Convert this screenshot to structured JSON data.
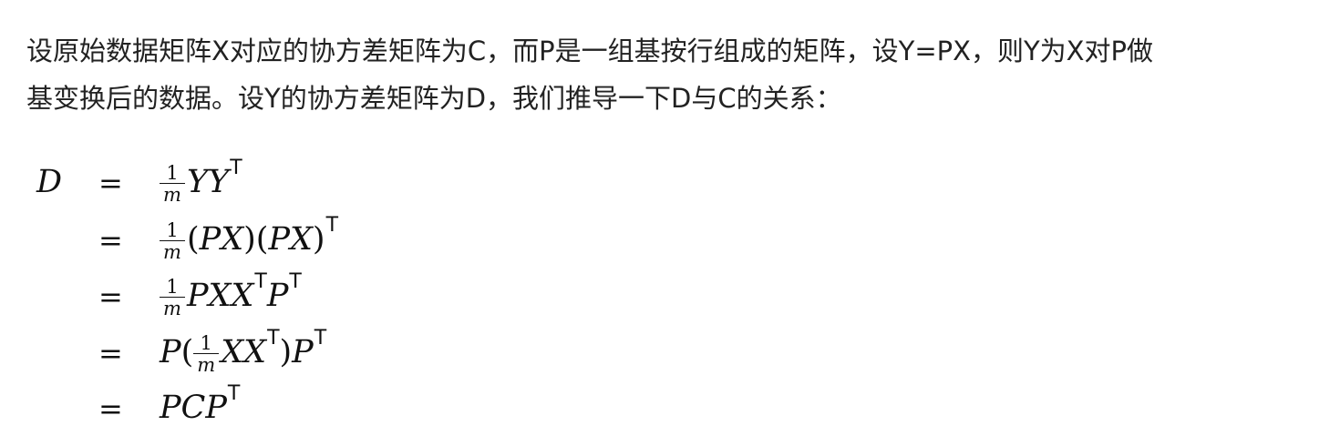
{
  "text": {
    "line1": "设原始数据矩阵X对应的协方差矩阵为C，而P是一组基按行组成的矩阵，设Y=PX，则Y为X对P做",
    "line2": "基变换后的数据。设Y的协方差矩阵为D，我们推导一下D与C的关系："
  },
  "math": {
    "lhs": "D",
    "equals": "=",
    "transpose": "T",
    "frac_numerator": "1",
    "frac_denominator": "m",
    "open_paren": "(",
    "close_paren": ")",
    "row1": {
      "term": "YY"
    },
    "row2": {
      "term1": "PX",
      "term2": "PX"
    },
    "row3": {
      "term1": "PXX",
      "term2": "P"
    },
    "row4": {
      "lead": "P",
      "term1": "XX",
      "term2": "P"
    },
    "row5": {
      "term": "PCP"
    }
  }
}
